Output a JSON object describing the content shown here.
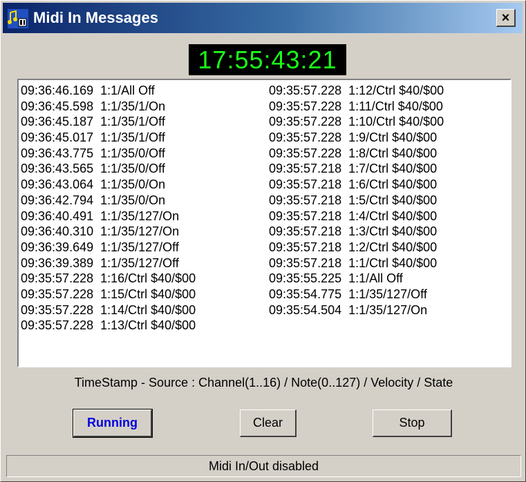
{
  "window": {
    "title": "Midi In Messages",
    "close_label": "×",
    "app_icon": "midi-notes-icon"
  },
  "clock": {
    "value": "17:55:43:21",
    "color": "#1aff1a"
  },
  "log": {
    "left": [
      "09:36:46.169  1:1/All Off",
      "09:36:45.598  1:1/35/1/On",
      "09:36:45.187  1:1/35/1/Off",
      "09:36:45.017  1:1/35/1/Off",
      "09:36:43.775  1:1/35/0/Off",
      "09:36:43.565  1:1/35/0/Off",
      "09:36:43.064  1:1/35/0/On",
      "09:36:42.794  1:1/35/0/On",
      "09:36:40.491  1:1/35/127/On",
      "09:36:40.310  1:1/35/127/On",
      "09:36:39.649  1:1/35/127/Off",
      "09:36:39.389  1:1/35/127/Off",
      "09:35:57.228  1:16/Ctrl $40/$00",
      "09:35:57.228  1:15/Ctrl $40/$00",
      "09:35:57.228  1:14/Ctrl $40/$00",
      "09:35:57.228  1:13/Ctrl $40/$00"
    ],
    "right": [
      "09:35:57.228  1:12/Ctrl $40/$00",
      "09:35:57.228  1:11/Ctrl $40/$00",
      "09:35:57.228  1:10/Ctrl $40/$00",
      "09:35:57.228  1:9/Ctrl $40/$00",
      "09:35:57.228  1:8/Ctrl $40/$00",
      "09:35:57.218  1:7/Ctrl $40/$00",
      "09:35:57.218  1:6/Ctrl $40/$00",
      "09:35:57.218  1:5/Ctrl $40/$00",
      "09:35:57.218  1:4/Ctrl $40/$00",
      "09:35:57.218  1:3/Ctrl $40/$00",
      "09:35:57.218  1:2/Ctrl $40/$00",
      "09:35:57.218  1:1/Ctrl $40/$00",
      "09:35:55.225  1:1/All Off",
      "09:35:54.775  1:1/35/127/Off",
      "09:35:54.504  1:1/35/127/On"
    ]
  },
  "legend": "TimeStamp - Source : Channel(1..16) / Note(0..127) / Velocity / State",
  "buttons": {
    "running": "Running",
    "clear": "Clear",
    "stop": "Stop"
  },
  "status": "Midi In/Out disabled",
  "colors": {
    "accent_running": "#0000e0",
    "title_gradient_start": "#0a246a",
    "title_gradient_end": "#a6caf0"
  }
}
